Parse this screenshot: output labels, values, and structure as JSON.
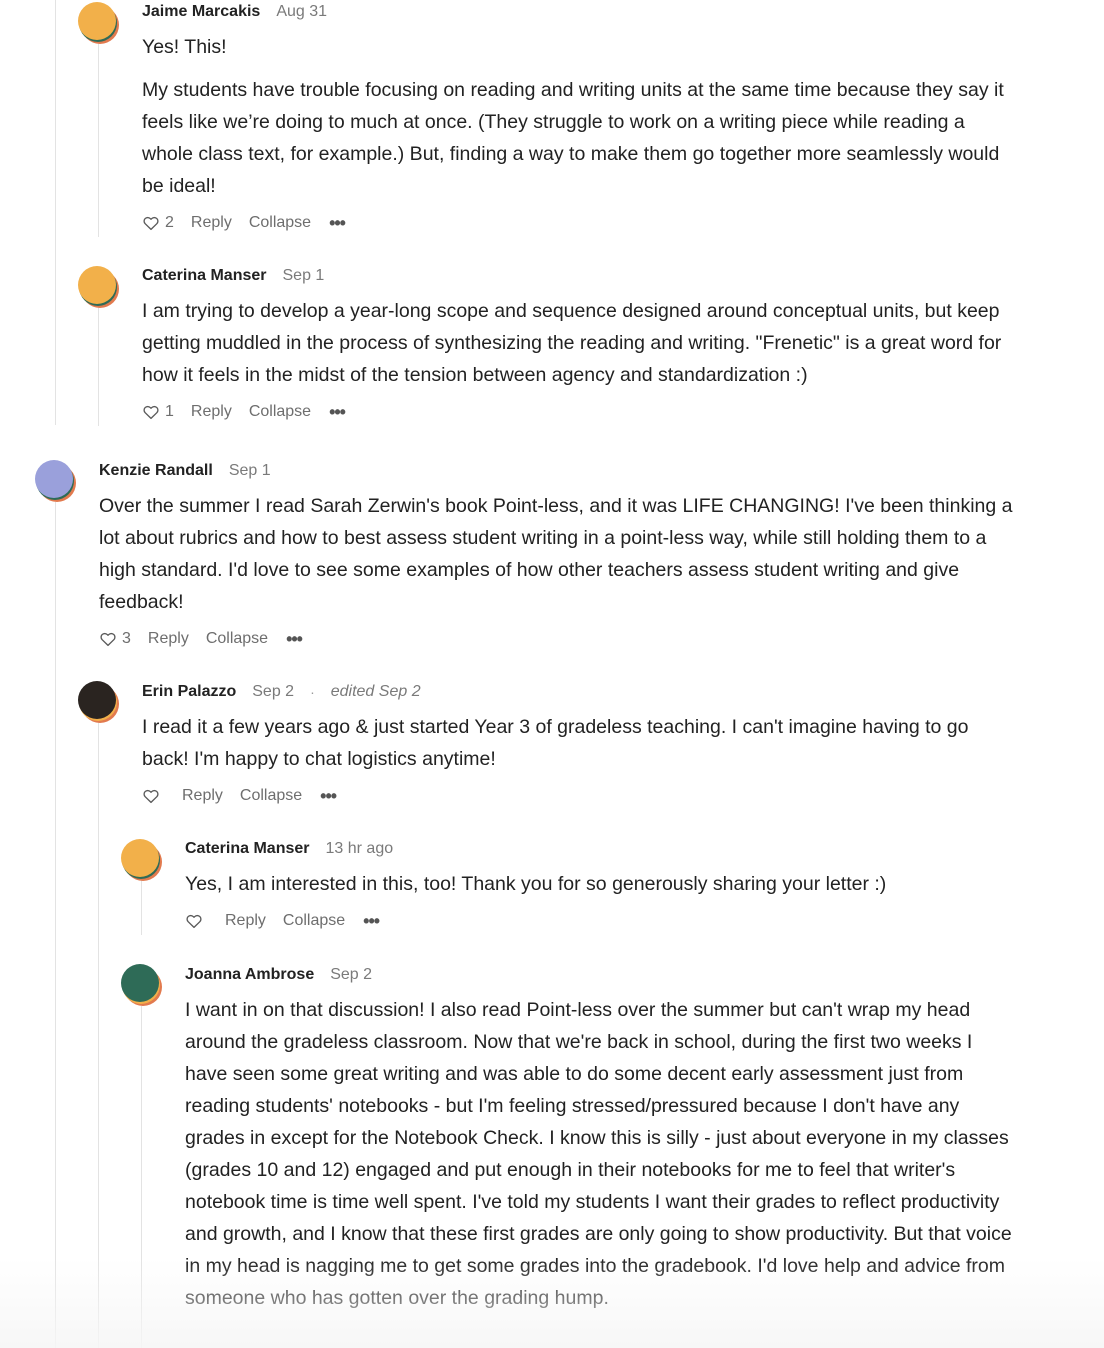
{
  "colors": {
    "orange": "#F2B04A",
    "green": "#2E6B57",
    "coral": "#E27A4E",
    "lavender": "#9AA0DB",
    "dark": "#2A2420",
    "text": "#222222",
    "muted": "#7A7A7A",
    "thread_line": "#E3E3E3"
  },
  "actions": {
    "reply": "Reply",
    "collapse": "Collapse",
    "more": "•••"
  },
  "comments": [
    {
      "author": "Jaime Marcakis",
      "date": "Aug 31",
      "avatar": "orange-avatar",
      "paragraphs": [
        "Yes! This!",
        "My students have trouble focusing on reading and writing units at the same time because they say it feels like we’re doing to much at once. (They struggle to work on a writing piece while reading a whole class text, for example.) But, finding a way to make them go together more seamlessly would be ideal!"
      ],
      "likes": "2"
    },
    {
      "author": "Caterina Manser",
      "date": "Sep 1",
      "avatar": "orange-avatar",
      "paragraphs": [
        "I am trying to develop a year-long scope and sequence designed around conceptual units, but keep getting muddled in the process of synthesizing the reading and writing. \"Frenetic\" is a great word for how it feels in the midst of the tension between agency and standardization :)"
      ],
      "likes": "1"
    },
    {
      "author": "Kenzie Randall",
      "date": "Sep 1",
      "avatar": "lavender-avatar",
      "paragraphs": [
        "Over the summer I read Sarah Zerwin's book Point-less, and it was LIFE CHANGING! I've been thinking a lot about rubrics and how to best assess student writing in a point-less way, while still holding them to a high standard. I'd love to see some examples of how other teachers assess student writing and give feedback!"
      ],
      "likes": "3"
    },
    {
      "author": "Erin Palazzo",
      "date": "Sep 2",
      "separator": "·",
      "edited": "edited Sep 2",
      "avatar": "dark-avatar",
      "paragraphs": [
        "I read it a few years ago & just started Year 3 of gradeless teaching. I can't imagine having to go back! I'm happy to chat logistics anytime!"
      ],
      "likes": ""
    },
    {
      "author": "Caterina Manser",
      "date": "13 hr ago",
      "avatar": "orange-avatar",
      "paragraphs": [
        "Yes, I am interested in this, too! Thank you for so generously sharing your letter :)"
      ],
      "likes": ""
    },
    {
      "author": "Joanna Ambrose",
      "date": "Sep 2",
      "avatar": "green-avatar",
      "paragraphs": [
        "I want in on that discussion! I also read Point-less over the summer but can't wrap my head around the gradeless classroom. Now that we're back in school, during the first two weeks I have seen some great writing and was able to do some decent early assessment just from reading students' notebooks - but I'm feeling stressed/pressured because I don't have any grades in except for the Notebook Check. I know this is silly - just about everyone in my classes (grades 10 and 12) engaged and put enough in their notebooks for me to feel that writer's notebook time is time well spent. I've told my students I want their grades to reflect productivity and growth, and I know that these first grades are only going to show productivity. But that voice in my head is nagging me to get some grades into the gradebook. I'd love help and advice from someone who has gotten over the grading hump."
      ],
      "likes": ""
    }
  ]
}
